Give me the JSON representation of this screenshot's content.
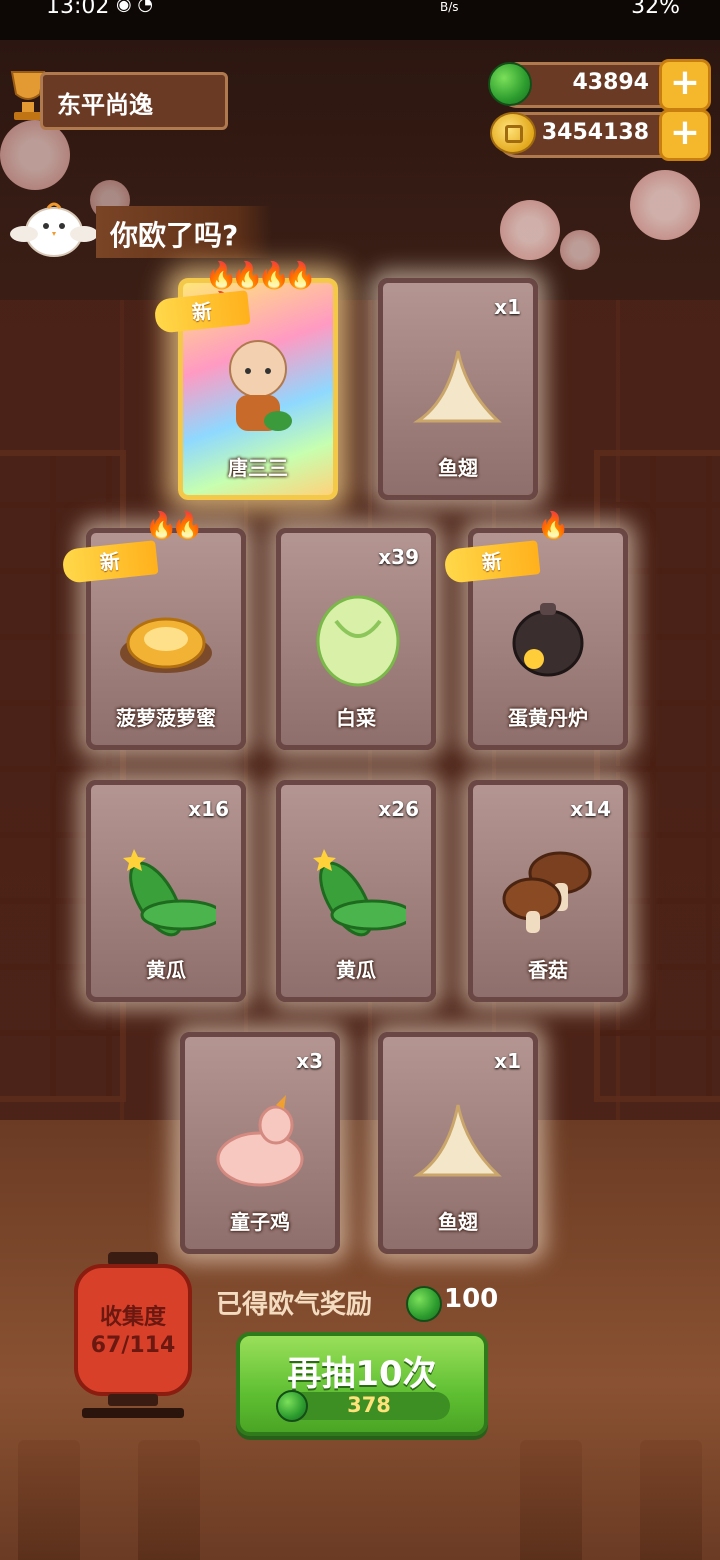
{
  "status_bar": {
    "time": "13:02",
    "net_speed": "B/s",
    "battery": "32%"
  },
  "player": {
    "name": "东平尚逸"
  },
  "resources": {
    "gems": "43894",
    "coins": "3454138"
  },
  "banner": {
    "text": "你欧了吗?"
  },
  "new_label": "新",
  "cards": [
    {
      "name": "唐三三",
      "count": "",
      "is_new": true,
      "stars": 5,
      "rarity": "legendary"
    },
    {
      "name": "鱼翅",
      "count": "x1",
      "is_new": false,
      "stars": 0
    },
    {
      "name": "菠萝菠萝蜜",
      "count": "",
      "is_new": true,
      "stars": 2
    },
    {
      "name": "白菜",
      "count": "x39",
      "is_new": false,
      "stars": 0
    },
    {
      "name": "蛋黄丹炉",
      "count": "",
      "is_new": true,
      "stars": 1
    },
    {
      "name": "黄瓜",
      "count": "x16",
      "is_new": false,
      "stars": 0
    },
    {
      "name": "黄瓜",
      "count": "x26",
      "is_new": false,
      "stars": 0
    },
    {
      "name": "香菇",
      "count": "x14",
      "is_new": false,
      "stars": 0
    },
    {
      "name": "童子鸡",
      "count": "x3",
      "is_new": false,
      "stars": 0
    },
    {
      "name": "鱼翅",
      "count": "x1",
      "is_new": false,
      "stars": 0
    }
  ],
  "collection": {
    "label": "收集度",
    "progress": "67/114"
  },
  "reward": {
    "label": "已得欧气奖励",
    "value": "100"
  },
  "draw_button": {
    "label": "再抽10次",
    "cost": "378"
  }
}
